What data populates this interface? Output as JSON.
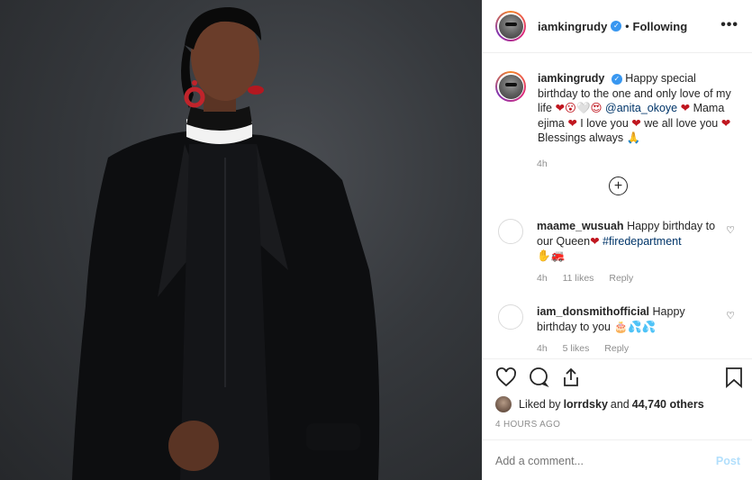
{
  "post": {
    "username": "iamkingrudy",
    "following_label": "Following",
    "more_label": "•••",
    "caption": {
      "username": "iamkingrudy",
      "part1": "Happy special birthday to the one and only love of my life ",
      "emoji1": "❤😮🤍😍 ",
      "mention": "@anita_okoye",
      "heart": " ❤",
      "part2": " Mama ejima ",
      "heart2": "❤",
      "part3": " I love you ",
      "heart3": "❤",
      "part4": " we all love you ",
      "heart4": "❤",
      "part5": " Blessings always 🙏",
      "time": "4h"
    }
  },
  "comments": [
    {
      "username": "maame_wusuah",
      "text": "Happy birthday to our Queen",
      "heart": "❤",
      "hashtag": " #firedepartment",
      "extra": "✋🚒",
      "time": "4h",
      "likes": "11 likes",
      "reply": "Reply"
    },
    {
      "username": "iam_donsmithofficial",
      "text": "Happy birthday to you 🎂💦💦",
      "time": "4h",
      "likes": "5 likes",
      "reply": "Reply"
    }
  ],
  "footer": {
    "liked_prefix": "Liked by ",
    "liked_user": "lorrdsky",
    "liked_and": " and ",
    "liked_count": "44,740 others",
    "post_time": "4 HOURS AGO",
    "add_comment_placeholder": "Add a comment...",
    "post_label": "Post"
  },
  "colors": {
    "verified": "#3897f0",
    "heart": "#c0161f",
    "link": "#003569",
    "post_button": "#b2dffc"
  }
}
